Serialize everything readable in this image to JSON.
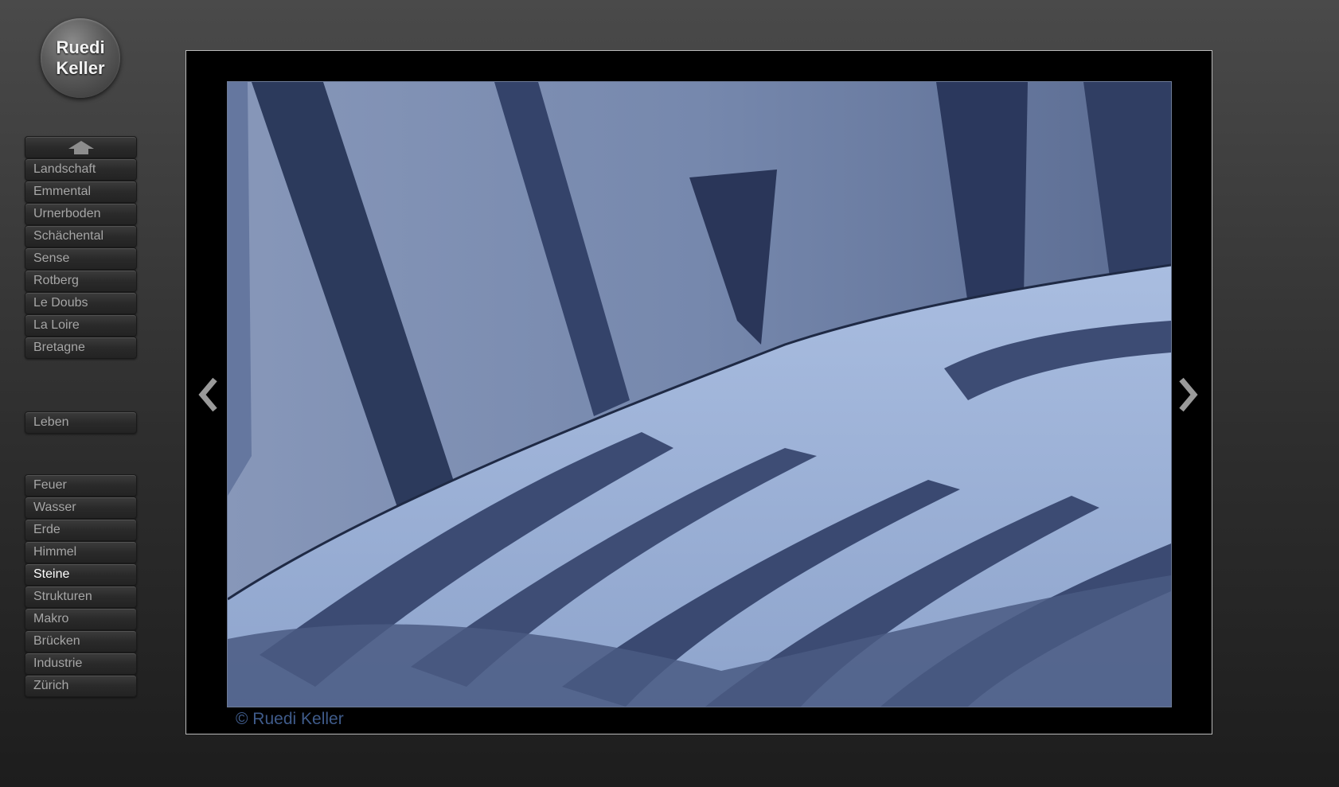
{
  "logo": {
    "line1": "Ruedi",
    "line2": "Keller"
  },
  "nav_group_1": {
    "home_icon": "home-icon",
    "items": [
      {
        "label": "Landschaft"
      },
      {
        "label": "Emmental"
      },
      {
        "label": "Urnerboden"
      },
      {
        "label": "Schächental"
      },
      {
        "label": "Sense"
      },
      {
        "label": "Rotberg"
      },
      {
        "label": "Le Doubs"
      },
      {
        "label": "La Loire"
      },
      {
        "label": "Bretagne"
      }
    ]
  },
  "nav_group_2": {
    "items": [
      {
        "label": "Leben"
      }
    ]
  },
  "nav_group_3": {
    "active": "Steine",
    "items": [
      {
        "label": "Feuer"
      },
      {
        "label": "Wasser"
      },
      {
        "label": "Erde"
      },
      {
        "label": "Himmel"
      },
      {
        "label": "Steine"
      },
      {
        "label": "Strukturen"
      },
      {
        "label": "Makro"
      },
      {
        "label": "Brücken"
      },
      {
        "label": "Industrie"
      },
      {
        "label": "Zürich"
      }
    ]
  },
  "viewer": {
    "prev_icon": "chevron-left-icon",
    "next_icon": "chevron-right-icon",
    "copyright": "© Ruedi Keller"
  },
  "colors": {
    "accent": "#3f5b8a",
    "nav_text": "#a6a6a6",
    "nav_active_text": "#ffffff",
    "photo_tint": "#5f7094"
  }
}
